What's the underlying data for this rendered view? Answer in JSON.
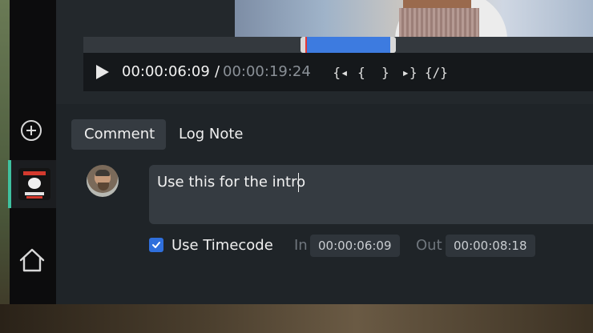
{
  "player": {
    "current_time": "00:00:06:09",
    "separator": "/",
    "total_time": "00:00:19:24",
    "controls": {
      "go_to_in": "{◂",
      "mark_in": "{",
      "mark_out": "}",
      "go_to_out": "▸}",
      "clear_marks": "{/}"
    },
    "range_color": "#3d7be0",
    "playhead_color": "#e53935"
  },
  "sidebar": {
    "items": [
      {
        "icon": "add-icon"
      },
      {
        "icon": "project-thumbnail",
        "active": true
      },
      {
        "icon": "home-icon"
      }
    ],
    "accent_color": "#3fc2a0"
  },
  "tabs": [
    {
      "label": "Comment",
      "active": true
    },
    {
      "label": "Log Note",
      "active": false
    }
  ],
  "comment": {
    "text": "Use this for the intro"
  },
  "timecode": {
    "use_timecode_label": "Use Timecode",
    "checked": true,
    "in_label": "In",
    "in_value": "00:00:06:09",
    "out_label": "Out",
    "out_value": "00:00:08:18"
  }
}
